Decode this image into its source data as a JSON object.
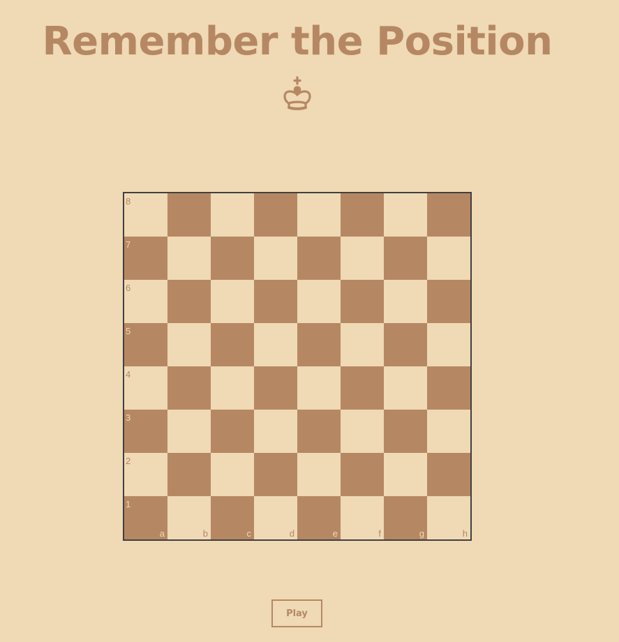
{
  "header": {
    "title": "Remember the Position"
  },
  "logo_icon": "chess-king-icon",
  "board": {
    "ranks": [
      "8",
      "7",
      "6",
      "5",
      "4",
      "3",
      "2",
      "1"
    ],
    "files": [
      "a",
      "b",
      "c",
      "d",
      "e",
      "f",
      "g",
      "h"
    ],
    "light_color": "#f0d9b5",
    "dark_color": "#b58863",
    "border_color": "#404040",
    "pieces": []
  },
  "controls": {
    "play_label": "Play"
  },
  "colors": {
    "background": "#f0d9b5",
    "accent": "#b58863"
  }
}
